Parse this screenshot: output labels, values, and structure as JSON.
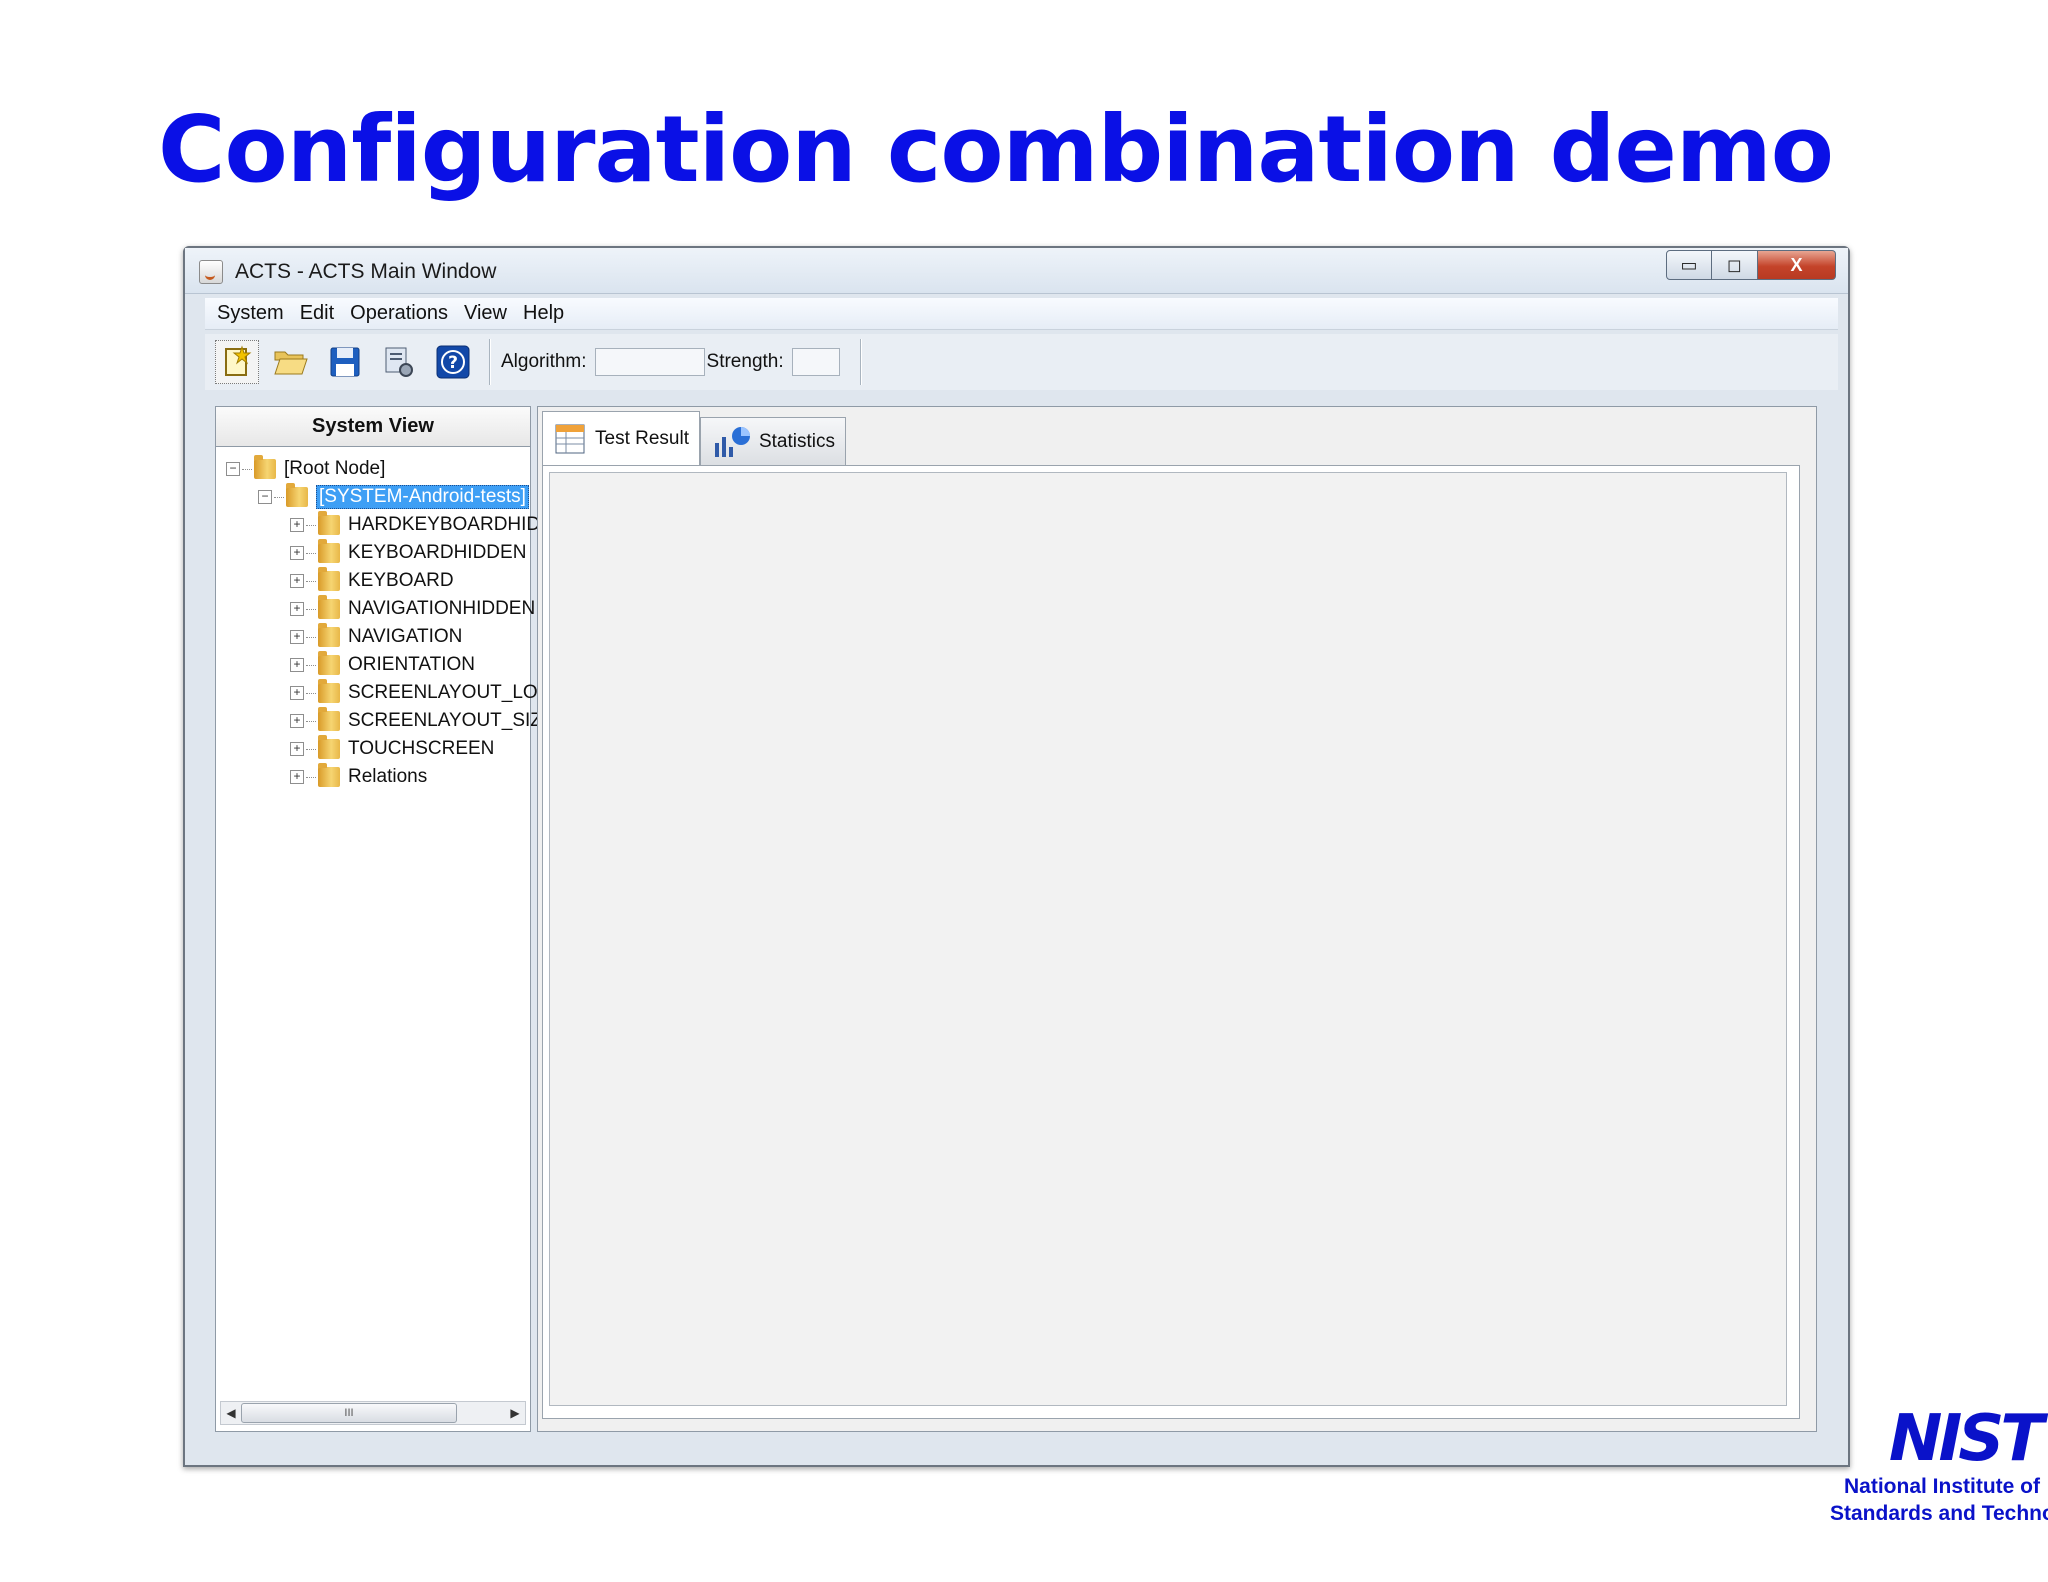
{
  "slide": {
    "title": "Configuration combination demo"
  },
  "window": {
    "title": "ACTS - ACTS Main Window",
    "controls": {
      "minimize": "▭",
      "maximize": "◻",
      "close": "X"
    }
  },
  "menubar": {
    "items": [
      "System",
      "Edit",
      "Operations",
      "View",
      "Help"
    ]
  },
  "toolbar": {
    "algorithm_label": "Algorithm:",
    "algorithm_value": "",
    "strength_label": "Strength:",
    "strength_value": ""
  },
  "system_view": {
    "header": "System View",
    "root": "[Root Node]",
    "system": "[SYSTEM-Android-tests]",
    "children": [
      "HARDKEYBOARDHIDI",
      "KEYBOARDHIDDEN",
      "KEYBOARD",
      "NAVIGATIONHIDDEN",
      "NAVIGATION",
      "ORIENTATION",
      "SCREENLAYOUT_LON",
      "SCREENLAYOUT_SIZ",
      "TOUCHSCREEN",
      "Relations"
    ],
    "scroll_thumb": "III"
  },
  "tabs": [
    {
      "label": "Test Result",
      "icon": "table-icon",
      "active": true
    },
    {
      "label": "Statistics",
      "icon": "chart-icon",
      "active": false
    }
  ],
  "logo": {
    "mark": "NIST",
    "line1": "National Institute of",
    "line2": "Standards and Technology"
  },
  "colors": {
    "title": "#0a10e6",
    "selection": "#3e9ff5",
    "logo": "#0a12c9"
  }
}
